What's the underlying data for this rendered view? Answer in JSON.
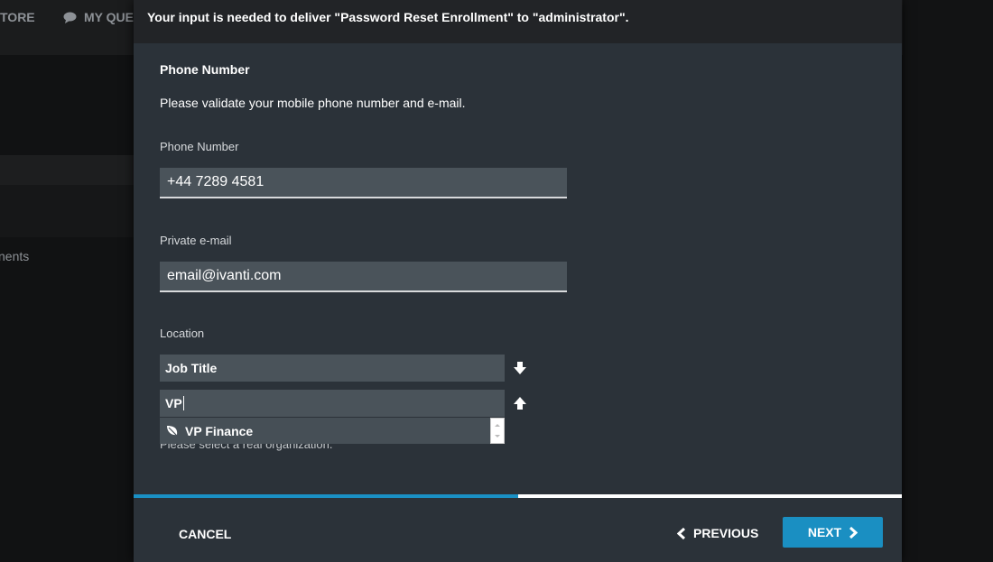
{
  "background": {
    "nav": [
      {
        "label": "TORE"
      },
      {
        "label": "MY QUEU",
        "icon": "chat-bubble-icon"
      }
    ],
    "sidebar_partial_text": "nents"
  },
  "dialog": {
    "header": "Your input is needed to deliver \"Password Reset Enrollment\" to \"administrator\".",
    "section_title": "Phone Number",
    "description": "Please validate your mobile phone number and e-mail.",
    "fields": {
      "phone": {
        "label": "Phone Number",
        "value": "+44 7289 4581"
      },
      "email": {
        "label": "Private e-mail",
        "value": "email@ivanti.com"
      },
      "location": {
        "label": "Location",
        "level1_value": "Job Title",
        "level2_value": "VP",
        "helper_text": "Please select a real organization.",
        "suggestions": [
          {
            "label": "VP Finance",
            "icon": "leaf-icon"
          }
        ]
      }
    },
    "progress_percent": 50,
    "buttons": {
      "cancel": "CANCEL",
      "previous": "PREVIOUS",
      "next": "NEXT"
    },
    "colors": {
      "accent": "#1a8fc2"
    }
  }
}
